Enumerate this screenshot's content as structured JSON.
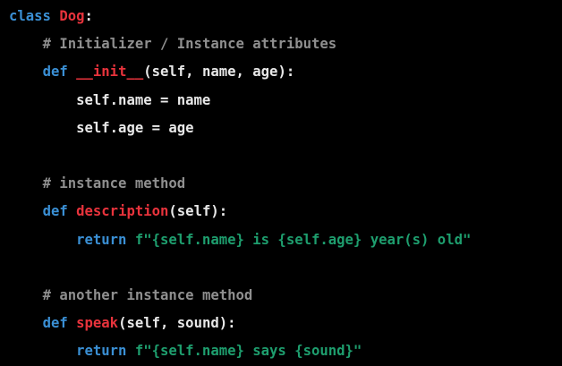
{
  "code": {
    "lines": [
      {
        "indent": "",
        "tokens": [
          {
            "type": "keyword",
            "text": "class "
          },
          {
            "type": "name",
            "text": "Dog"
          },
          {
            "type": "plain",
            "text": ":"
          }
        ]
      },
      {
        "indent": "    ",
        "tokens": [
          {
            "type": "comment",
            "text": "# Initializer / Instance attributes"
          }
        ]
      },
      {
        "indent": "    ",
        "tokens": [
          {
            "type": "keyword",
            "text": "def "
          },
          {
            "type": "name",
            "text": "__init__"
          },
          {
            "type": "plain",
            "text": "(self, name, age):"
          }
        ]
      },
      {
        "indent": "        ",
        "tokens": [
          {
            "type": "plain",
            "text": "self.name = name"
          }
        ]
      },
      {
        "indent": "        ",
        "tokens": [
          {
            "type": "plain",
            "text": "self.age = age"
          }
        ]
      },
      {
        "indent": "",
        "tokens": []
      },
      {
        "indent": "    ",
        "tokens": [
          {
            "type": "comment",
            "text": "# instance method"
          }
        ]
      },
      {
        "indent": "    ",
        "tokens": [
          {
            "type": "keyword",
            "text": "def "
          },
          {
            "type": "name",
            "text": "description"
          },
          {
            "type": "plain",
            "text": "(self):"
          }
        ]
      },
      {
        "indent": "        ",
        "tokens": [
          {
            "type": "keyword",
            "text": "return "
          },
          {
            "type": "string",
            "text": "f\"{self.name} is {self.age} year(s) old\""
          }
        ]
      },
      {
        "indent": "",
        "tokens": []
      },
      {
        "indent": "    ",
        "tokens": [
          {
            "type": "comment",
            "text": "# another instance method"
          }
        ]
      },
      {
        "indent": "    ",
        "tokens": [
          {
            "type": "keyword",
            "text": "def "
          },
          {
            "type": "name",
            "text": "speak"
          },
          {
            "type": "plain",
            "text": "(self, sound):"
          }
        ]
      },
      {
        "indent": "        ",
        "tokens": [
          {
            "type": "keyword",
            "text": "return "
          },
          {
            "type": "string",
            "text": "f\"{self.name} says {sound}\""
          }
        ]
      }
    ]
  },
  "colors": {
    "background": "#000000",
    "keyword": "#3a8fd4",
    "name": "#e8333c",
    "plain": "#e8e8e8",
    "comment": "#8f8f8f",
    "string": "#1e9e6e"
  }
}
